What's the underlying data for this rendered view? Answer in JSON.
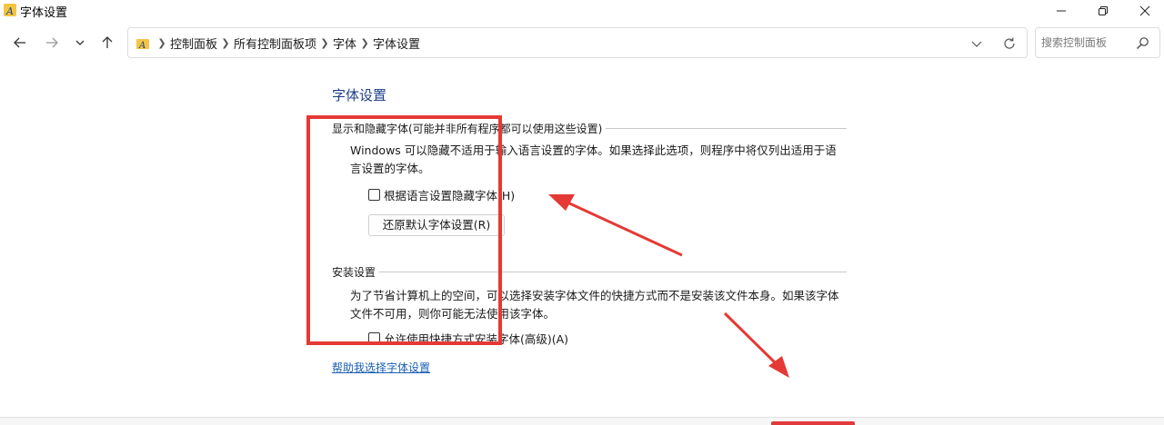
{
  "window": {
    "title": "字体设置"
  },
  "nav": {
    "breadcrumbs": [
      "控制面板",
      "所有控制面板项",
      "字体",
      "字体设置"
    ],
    "search_placeholder": "搜索控制面板"
  },
  "page": {
    "title": "字体设置",
    "show_hide_group": {
      "heading": "显示和隐藏字体(可能并非所有程序都可以使用这些设置)",
      "description": "Windows 可以隐藏不适用于输入语言设置的字体。如果选择此选项，则程序中将仅列出适用于语言设置的字体。",
      "hide_checkbox_label": "根据语言设置隐藏字体(H)",
      "hide_checkbox_checked": false,
      "restore_button_label": "还原默认字体设置(R)"
    },
    "install_group": {
      "heading": "安装设置",
      "description": "为了节省计算机上的空间，可以选择安装字体文件的快捷方式而不是安装该文件本身。如果该字体文件不可用，则你可能无法使用该字体。",
      "shortcut_checkbox_label": "允许使用快捷方式安装字体(高级)(A)",
      "shortcut_checkbox_checked": false
    },
    "help_link": "帮助我选择字体设置"
  },
  "colors": {
    "annotation_red": "#e53935",
    "title_blue": "#1e3f8a",
    "link_blue": "#1a5fb4"
  }
}
